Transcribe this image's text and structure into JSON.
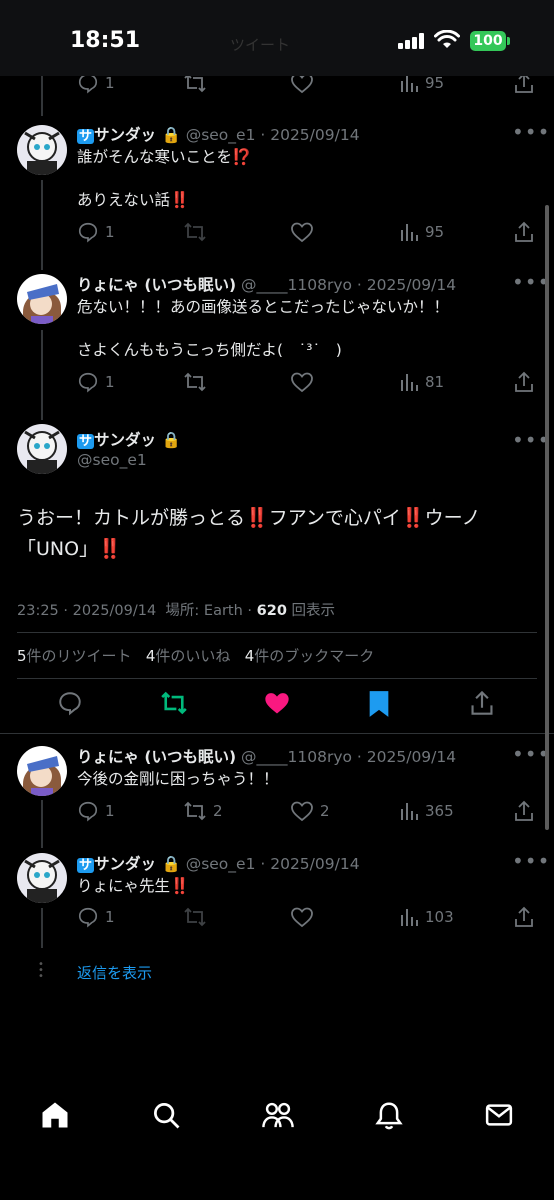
{
  "status_bar": {
    "time": "18:51",
    "battery": "100",
    "background_title": "ツイート"
  },
  "tweets": [
    {
      "id": "top",
      "counts": {
        "reply": "1",
        "views": "95"
      }
    },
    {
      "id": "t1",
      "name": "サンダッ",
      "handle": "@seo_e1",
      "date": "2025/09/14",
      "line1": "誰がそんな寒いことを",
      "line1_mark": "⁉️",
      "line2": "ありえない話",
      "line2_mark": "‼️",
      "counts": {
        "reply": "1",
        "views": "95"
      }
    },
    {
      "id": "t2",
      "name": "りょにゃ (いつも眠い)",
      "handle": "@____1108ryo",
      "date": "2025/09/14",
      "line1": "危ない！！！あの画像送るとこだったじゃないか！！",
      "line2": "さよくんももうこっち側だよ(　˙³˙　)",
      "counts": {
        "reply": "1",
        "views": "81"
      }
    }
  ],
  "main_tweet": {
    "name": "サンダッ",
    "handle": "@seo_e1",
    "text_a": "うおー！カトルが勝っとる",
    "mark_a": "‼️",
    "text_b": "フアンで心パイ",
    "mark_b": "‼️",
    "text_c": "ウーノ",
    "text_d": "「UNO」",
    "mark_d": "‼️",
    "time": "23:25",
    "date": "2025/09/14",
    "location_label": "場所: Earth",
    "views": "620",
    "views_label": "回表示",
    "retweets": "5",
    "retweets_label": "件のリツイート",
    "likes": "4",
    "likes_label": "件のいいね",
    "bookmarks": "4",
    "bookmarks_label": "件のブックマーク",
    "colors": {
      "retweet": "#00ba7c",
      "like": "#f91880",
      "bookmark": "#1d9bf0"
    }
  },
  "replies": [
    {
      "id": "r1",
      "name": "りょにゃ (いつも眠い)",
      "handle": "@____1108ryo",
      "date": "2025/09/14",
      "text": "今後の金剛に困っちゃう！！",
      "counts": {
        "reply": "1",
        "retweet": "2",
        "like": "2",
        "views": "365"
      }
    },
    {
      "id": "r2",
      "name": "サンダッ",
      "handle": "@seo_e1",
      "date": "2025/09/14",
      "text": "りょにゃ先生",
      "mark": "‼️",
      "counts": {
        "reply": "1",
        "views": "103"
      }
    }
  ],
  "show_replies": "返信を表示",
  "tabbar": [
    "home-icon",
    "search-icon",
    "communities-icon",
    "notifications-icon",
    "messages-icon"
  ]
}
